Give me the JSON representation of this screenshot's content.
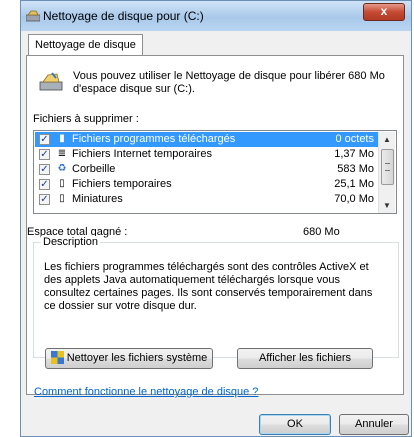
{
  "window": {
    "title": "Nettoyage de disque pour  (C:)",
    "close_glyph": "x"
  },
  "tabs": [
    {
      "label": "Nettoyage de disque"
    }
  ],
  "intro": {
    "icon": "disk-cleanup-icon",
    "text": "Vous pouvez utiliser le Nettoyage de disque pour libérer 680 Mo d'espace disque sur  (C:)."
  },
  "files": {
    "label": "Fichiers à supprimer :",
    "items": [
      {
        "name": "Fichiers programmes téléchargés",
        "size": "0 octets",
        "checked": true,
        "selected": true,
        "icon": "folder-icon"
      },
      {
        "name": "Fichiers Internet temporaires",
        "size": "1,37 Mo",
        "checked": true,
        "selected": false,
        "icon": "document-icon"
      },
      {
        "name": "Corbeille",
        "size": "583 Mo",
        "checked": true,
        "selected": false,
        "icon": "recycle-bin-icon"
      },
      {
        "name": "Fichiers temporaires",
        "size": "25,1 Mo",
        "checked": true,
        "selected": false,
        "icon": "blank-file-icon"
      },
      {
        "name": "Miniatures",
        "size": "70,0 Mo",
        "checked": true,
        "selected": false,
        "icon": "blank-file-icon"
      }
    ]
  },
  "total": {
    "label": "Espace total gagné :",
    "value": "680 Mo"
  },
  "description": {
    "legend": "Description",
    "text": "Les fichiers programmes téléchargés sont des contrôles ActiveX et des applets Java automatiquement téléchargés lorsque vous consultez certaines pages. Ils sont conservés temporairement dans ce dossier sur votre disque dur."
  },
  "buttons": {
    "clean_system": "Nettoyer les fichiers système",
    "view_files": "Afficher les fichiers",
    "ok": "OK",
    "cancel": "Annuler"
  },
  "help_link": "Comment fonctionne le nettoyage de disque ?",
  "colors": {
    "selection": "#3399ff",
    "link": "#0066cc",
    "close": "#c44a33"
  }
}
